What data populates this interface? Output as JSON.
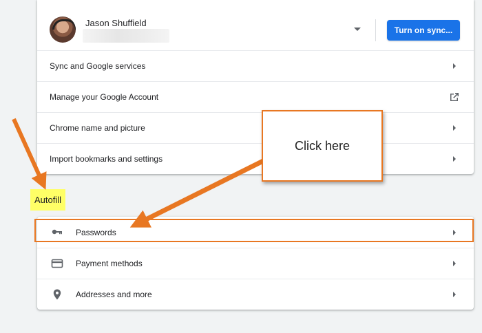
{
  "profile": {
    "name": "Jason Shuffield",
    "sync_button": "Turn on sync..."
  },
  "you_section": {
    "items": [
      {
        "label": "Sync and Google services",
        "trailing": "chevron-right-icon"
      },
      {
        "label": "Manage your Google Account",
        "trailing": "open-in-new-icon"
      },
      {
        "label": "Chrome name and picture",
        "trailing": "chevron-right-icon"
      },
      {
        "label": "Import bookmarks and settings",
        "trailing": "chevron-right-icon"
      }
    ]
  },
  "autofill": {
    "heading": "Autofill",
    "items": [
      {
        "label": "Passwords",
        "icon": "key-icon"
      },
      {
        "label": "Payment methods",
        "icon": "credit-card-icon"
      },
      {
        "label": "Addresses and more",
        "icon": "location-pin-icon"
      }
    ]
  },
  "annotation": {
    "callout_text": "Click here",
    "accent_color": "#e87722",
    "highlight_color": "#ffff66"
  },
  "colors": {
    "primary_button": "#1a73e8",
    "page_background": "#f1f3f4"
  }
}
